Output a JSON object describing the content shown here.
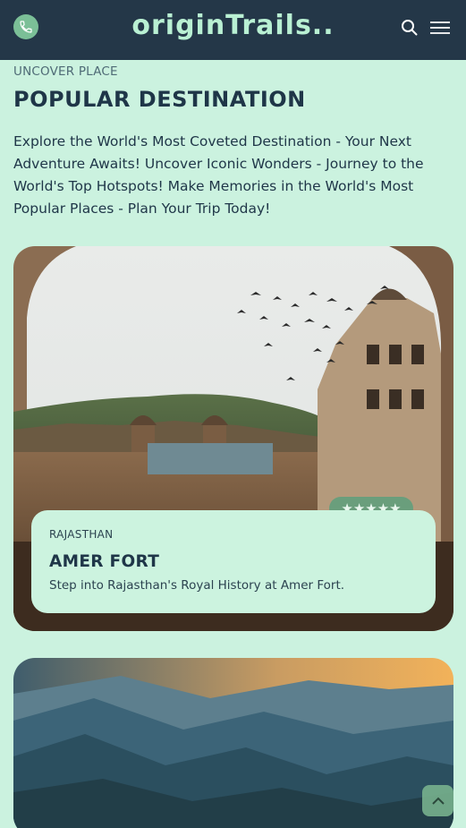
{
  "header": {
    "logo": "originTrails..",
    "icons": {
      "phone": "phone-icon",
      "search": "search-icon",
      "menu": "hamburger-menu-icon"
    }
  },
  "section": {
    "eyebrow": "UNCOVER PLACE",
    "title": "POPULAR DESTINATION",
    "intro": "Explore the World's Most Coveted Destination - Your Next Adventure Awaits! Uncover Iconic Wonders - Journey to the World's Top Hotspots! Make Memories in the World's Most Popular Places - Plan Your Trip Today!"
  },
  "destinations": [
    {
      "region": "RAJASTHAN",
      "name": "AMER FORT",
      "description": "Step into Rajasthan's Royal History at Amer Fort.",
      "rating_stars": "★★★★★",
      "rating": 5
    }
  ],
  "colors": {
    "header_bg": "#243748",
    "page_bg": "#cbf2df",
    "accent": "#7bbf97",
    "logo": "#b9f0d3"
  },
  "scroll_top_icon": "chevron-up-icon"
}
